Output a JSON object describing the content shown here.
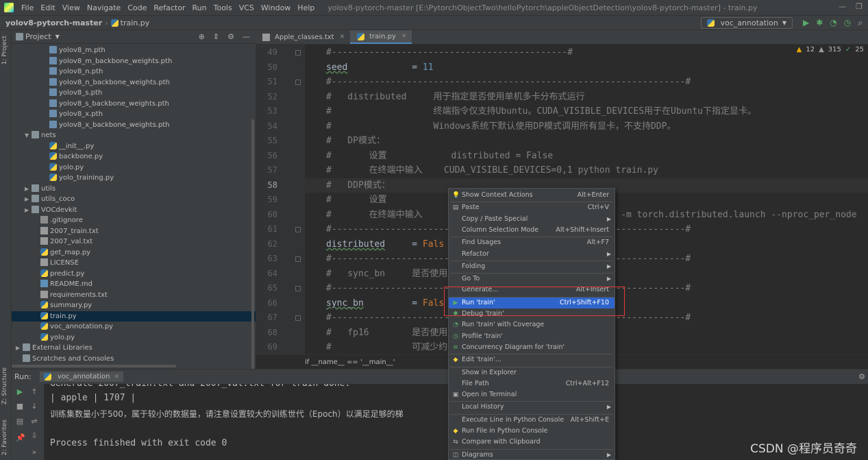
{
  "menubar": {
    "items": [
      "File",
      "Edit",
      "View",
      "Navigate",
      "Code",
      "Refactor",
      "Run",
      "Tools",
      "VCS",
      "Window",
      "Help"
    ],
    "window_title": "yolov8-pytorch-master [E:\\PytorchObjectTwo\\helloPytorch\\appleObjectDetection\\yolov8-pytorch-master] - train.py"
  },
  "navbar": {
    "project": "yolov8-pytorch-master",
    "file": "train.py",
    "run_config": "voc_annotation"
  },
  "left_strip": {
    "project_tab": "1: Project",
    "structure_tab": "Z: Structure",
    "favorites_tab": "2: Favorites"
  },
  "project_panel": {
    "title": "Project",
    "tree": [
      {
        "name": "yolov8_m.pth",
        "indent": 3,
        "icon": "file"
      },
      {
        "name": "yolov8_m_backbone_weights.pth",
        "indent": 3,
        "icon": "file"
      },
      {
        "name": "yolov8_n.pth",
        "indent": 3,
        "icon": "file"
      },
      {
        "name": "yolov8_n_backbone_weights.pth",
        "indent": 3,
        "icon": "file"
      },
      {
        "name": "yolov8_s.pth",
        "indent": 3,
        "icon": "file"
      },
      {
        "name": "yolov8_s_backbone_weights.pth",
        "indent": 3,
        "icon": "file"
      },
      {
        "name": "yolov8_x.pth",
        "indent": 3,
        "icon": "file"
      },
      {
        "name": "yolov8_x_backbone_weights.pth",
        "indent": 3,
        "icon": "file"
      },
      {
        "name": "nets",
        "indent": 1,
        "icon": "folder",
        "arrow": "down"
      },
      {
        "name": "__init__.py",
        "indent": 3,
        "icon": "py"
      },
      {
        "name": "backbone.py",
        "indent": 3,
        "icon": "py"
      },
      {
        "name": "yolo.py",
        "indent": 3,
        "icon": "py"
      },
      {
        "name": "yolo_training.py",
        "indent": 3,
        "icon": "py"
      },
      {
        "name": "utils",
        "indent": 1,
        "icon": "folder",
        "arrow": "right"
      },
      {
        "name": "utils_coco",
        "indent": 1,
        "icon": "folder",
        "arrow": "right"
      },
      {
        "name": "VOCdevkit",
        "indent": 1,
        "icon": "folder",
        "arrow": "right"
      },
      {
        "name": ".gitignore",
        "indent": 2,
        "icon": "git"
      },
      {
        "name": "2007_train.txt",
        "indent": 2,
        "icon": "txt"
      },
      {
        "name": "2007_val.txt",
        "indent": 2,
        "icon": "txt"
      },
      {
        "name": "get_map.py",
        "indent": 2,
        "icon": "py"
      },
      {
        "name": "LICENSE",
        "indent": 2,
        "icon": "txt"
      },
      {
        "name": "predict.py",
        "indent": 2,
        "icon": "py"
      },
      {
        "name": "README.md",
        "indent": 2,
        "icon": "md"
      },
      {
        "name": "requirements.txt",
        "indent": 2,
        "icon": "txt"
      },
      {
        "name": "summary.py",
        "indent": 2,
        "icon": "py"
      },
      {
        "name": "train.py",
        "indent": 2,
        "icon": "py",
        "selected": true
      },
      {
        "name": "voc_annotation.py",
        "indent": 2,
        "icon": "py"
      },
      {
        "name": "yolo.py",
        "indent": 2,
        "icon": "py"
      },
      {
        "name": "External Libraries",
        "indent": 0,
        "icon": "folder",
        "arrow": "right"
      },
      {
        "name": "Scratches and Consoles",
        "indent": 0,
        "icon": "folder"
      }
    ]
  },
  "editor_tabs": [
    {
      "label": "Apple_classes.txt",
      "active": false
    },
    {
      "label": "train.py",
      "active": true
    }
  ],
  "inspection": {
    "warnings": "12",
    "weak_warnings": "315",
    "ok": "25"
  },
  "editor": {
    "current_line": 58,
    "lines": [
      {
        "n": 49,
        "fold": true,
        "parts": [
          {
            "t": "#--------------------------------------------#",
            "c": "cmt"
          }
        ]
      },
      {
        "n": 50,
        "parts": [
          {
            "t": "seed",
            "c": "squig"
          },
          {
            "t": "            = ",
            "c": ""
          },
          {
            "t": "11",
            "c": "num"
          }
        ]
      },
      {
        "n": 51,
        "fold": true,
        "parts": [
          {
            "t": "#------------------------------------------------------------------#",
            "c": "cmt"
          }
        ]
      },
      {
        "n": 52,
        "parts": [
          {
            "t": "#   distributed     用于指定是否使用单机多卡分布式运行",
            "c": "cmt"
          }
        ]
      },
      {
        "n": 53,
        "parts": [
          {
            "t": "#                   终端指令仅支持Ubuntu。CUDA_VISIBLE_DEVICES用于在Ubuntu下指定显卡。",
            "c": "cmt"
          }
        ]
      },
      {
        "n": 54,
        "parts": [
          {
            "t": "#                   Windows系统下默认使用DP模式调用所有显卡，不支持DDP。",
            "c": "cmt"
          }
        ]
      },
      {
        "n": 55,
        "parts": [
          {
            "t": "#   DP模式：",
            "c": "cmt"
          }
        ]
      },
      {
        "n": 56,
        "parts": [
          {
            "t": "#       设置            distributed = False",
            "c": "cmt"
          }
        ]
      },
      {
        "n": 57,
        "parts": [
          {
            "t": "#       在终端中输入    CUDA_VISIBLE_DEVICES=0,1 python train.py",
            "c": "cmt"
          }
        ]
      },
      {
        "n": 58,
        "parts": [
          {
            "t": "#   DDP模式：",
            "c": "cmt"
          }
        ]
      },
      {
        "n": 59,
        "parts": [
          {
            "t": "#       设置",
            "c": "cmt"
          }
        ]
      },
      {
        "n": 60,
        "parts": [
          {
            "t": "#       在终端中输入                                  on -m torch.distributed.launch --nproc_per_node",
            "c": "cmt"
          }
        ]
      },
      {
        "n": 61,
        "fold": true,
        "parts": [
          {
            "t": "#------------------------------------------------------------------#",
            "c": "cmt"
          }
        ]
      },
      {
        "n": 62,
        "parts": [
          {
            "t": "distributed",
            "c": "squig"
          },
          {
            "t": "     = ",
            "c": ""
          },
          {
            "t": "Fals",
            "c": "kw"
          }
        ]
      },
      {
        "n": 63,
        "fold": true,
        "parts": [
          {
            "t": "#------------------------------------------------------------------#",
            "c": "cmt"
          }
        ]
      },
      {
        "n": 64,
        "parts": [
          {
            "t": "#   sync_bn     是否使用",
            "c": "cmt"
          }
        ]
      },
      {
        "n": 65,
        "fold": true,
        "parts": [
          {
            "t": "#------------------------------------------------------------------#",
            "c": "cmt"
          }
        ]
      },
      {
        "n": 66,
        "parts": [
          {
            "t": "sync_bn",
            "c": "squig"
          },
          {
            "t": "         = ",
            "c": ""
          },
          {
            "t": "Fals",
            "c": "kw"
          }
        ]
      },
      {
        "n": 67,
        "fold": true,
        "parts": [
          {
            "t": "#------------------------------------------------------------------#",
            "c": "cmt"
          }
        ]
      },
      {
        "n": 68,
        "parts": [
          {
            "t": "#   fp16        是否使用",
            "c": "cmt"
          }
        ]
      },
      {
        "n": 69,
        "parts": [
          {
            "t": "#               可减少约",
            "c": "cmt"
          }
        ]
      }
    ],
    "breadcrumb": "if __name__ == '__main__'"
  },
  "run_panel": {
    "label": "Run:",
    "tab": "voc_annotation",
    "console": [
      "Generate 2007_train.txt and 2007_val.txt for train done.",
      "| apple | 1707 |",
      "训练集数量小于500，属于较小的数据量，请注意设置较大的训练世代（Epoch）以满足足够的梯",
      "",
      "Process finished with exit code 0"
    ]
  },
  "watermark": "CSDN @程序员奇奇",
  "context_menu": {
    "items": [
      {
        "label": "Show Context Actions",
        "shortcut": "Alt+Enter",
        "icon": "bulb-icon"
      },
      {
        "sep": true
      },
      {
        "label": "Paste",
        "shortcut": "Ctrl+V",
        "icon": "paste-icon"
      },
      {
        "label": "Copy / Paste Special",
        "submenu": true
      },
      {
        "label": "Column Selection Mode",
        "shortcut": "Alt+Shift+Insert"
      },
      {
        "sep": true
      },
      {
        "label": "Find Usages",
        "shortcut": "Alt+F7"
      },
      {
        "label": "Refactor",
        "submenu": true
      },
      {
        "sep": true
      },
      {
        "label": "Folding",
        "submenu": true
      },
      {
        "sep": true
      },
      {
        "label": "Go To",
        "submenu": true
      },
      {
        "label": "Generate...",
        "shortcut": "Alt+Insert"
      },
      {
        "sep": true
      },
      {
        "label": "Run 'train'",
        "shortcut": "Ctrl+Shift+F10",
        "icon": "run-icon",
        "highlight": true
      },
      {
        "label": "Debug 'train'",
        "icon": "debug-icon"
      },
      {
        "label": "Run 'train' with Coverage",
        "icon": "coverage-icon"
      },
      {
        "label": "Profile 'train'",
        "icon": "profile-icon"
      },
      {
        "label": "Concurrency Diagram for 'train'",
        "icon": "concurrency-icon"
      },
      {
        "sep": true
      },
      {
        "label": "Edit 'train'...",
        "icon": "python-icon"
      },
      {
        "sep": true
      },
      {
        "label": "Show in Explorer"
      },
      {
        "label": "File Path",
        "shortcut": "Ctrl+Alt+F12"
      },
      {
        "label": "Open in Terminal",
        "icon": "terminal-icon"
      },
      {
        "sep": true
      },
      {
        "label": "Local History",
        "submenu": true
      },
      {
        "sep": true
      },
      {
        "label": "Execute Line in Python Console",
        "shortcut": "Alt+Shift+E"
      },
      {
        "label": "Run File in Python Console",
        "icon": "python-icon"
      },
      {
        "label": "Compare with Clipboard",
        "icon": "compare-icon"
      },
      {
        "sep": true
      },
      {
        "label": "Diagrams",
        "submenu": true,
        "icon": "diagram-icon"
      }
    ]
  },
  "colors": {
    "highlight": "#2f65ca",
    "annotation_box": "#e53935",
    "accent": "#4a88c7"
  }
}
